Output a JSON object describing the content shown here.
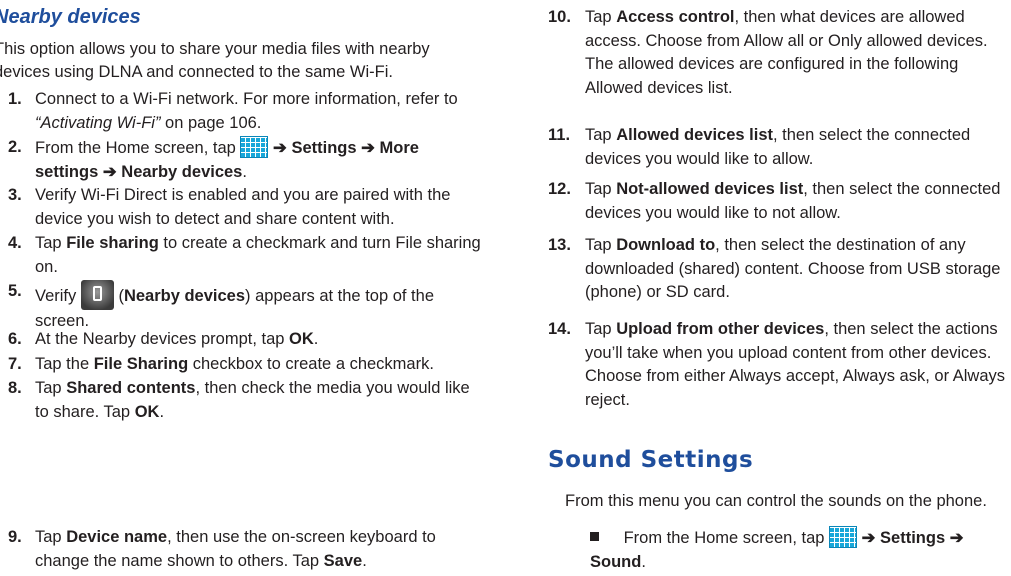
{
  "left": {
    "heading": "Nearby devices",
    "intro": "This option allows you to share your media files with nearby devices using DLNA and connected to the same Wi-Fi.",
    "steps": [
      {
        "num": "1.",
        "a": "Connect to a Wi-Fi network. For more information, refer to ",
        "ref": "“Activating Wi-Fi”",
        "b": " on page 106."
      },
      {
        "num": "2.",
        "a": "From the Home screen, tap ",
        "arrow": "➔",
        "s1": "Settings",
        "s2": "More settings",
        "s3": "Nearby devices",
        "end": "."
      },
      {
        "num": "3.",
        "text": "Verify Wi-Fi Direct is enabled and you are paired with the device you wish to detect and share content with."
      },
      {
        "num": "4.",
        "a": "Tap ",
        "bold": "File sharing",
        "b": " to create a checkmark and turn File sharing on."
      },
      {
        "num": "5.",
        "a": "Verify ",
        "bold": "Nearby devices",
        "b": " appears at the top of the screen."
      },
      {
        "num": "6.",
        "a": "At the Nearby devices prompt, tap ",
        "bold": "OK",
        "b": "."
      },
      {
        "num": "7.",
        "a": "Tap the ",
        "bold": "File Sharing",
        "b": " checkbox to create a checkmark."
      },
      {
        "num": "8.",
        "a": "Tap ",
        "bold": "Shared contents",
        "b": ", then check the media you would like to share. Tap ",
        "bold2": "OK",
        "c": "."
      },
      {
        "num": "9.",
        "a": "Tap ",
        "bold": "Device name",
        "b": ", then use the on-screen keyboard to change the name shown to others. Tap ",
        "bold2": "Save",
        "c": "."
      }
    ]
  },
  "right": {
    "steps": [
      {
        "num": "10.",
        "a": "Tap ",
        "bold": "Access control",
        "b": ", then what devices are allowed access. Choose from Allow all or Only allowed devices. The allowed devices are configured in the following Allowed devices list."
      },
      {
        "num": "11.",
        "a": "Tap ",
        "bold": "Allowed devices list",
        "b": ", then select the connected devices you would like to allow."
      },
      {
        "num": "12.",
        "a": "Tap ",
        "bold": "Not-allowed devices list",
        "b": ", then select the connected devices you would like to not allow."
      },
      {
        "num": "13.",
        "a": "Tap ",
        "bold": "Download to",
        "b": ", then select the destination of any downloaded (shared) content. Choose from USB storage (phone) or SD card."
      },
      {
        "num": "14.",
        "a": "Tap ",
        "bold": "Upload from other devices",
        "b": ", then select the actions you’ll take when you upload content from other devices. Choose from either Always accept, Always ask, or Always reject."
      }
    ],
    "heading": "Sound Settings",
    "intro": "From this menu you can control the sounds on the phone.",
    "bullet": {
      "a": "From the Home screen, tap ",
      "arrow": "➔",
      "s1": "Settings",
      "s2": "Sound",
      "end": "."
    }
  }
}
